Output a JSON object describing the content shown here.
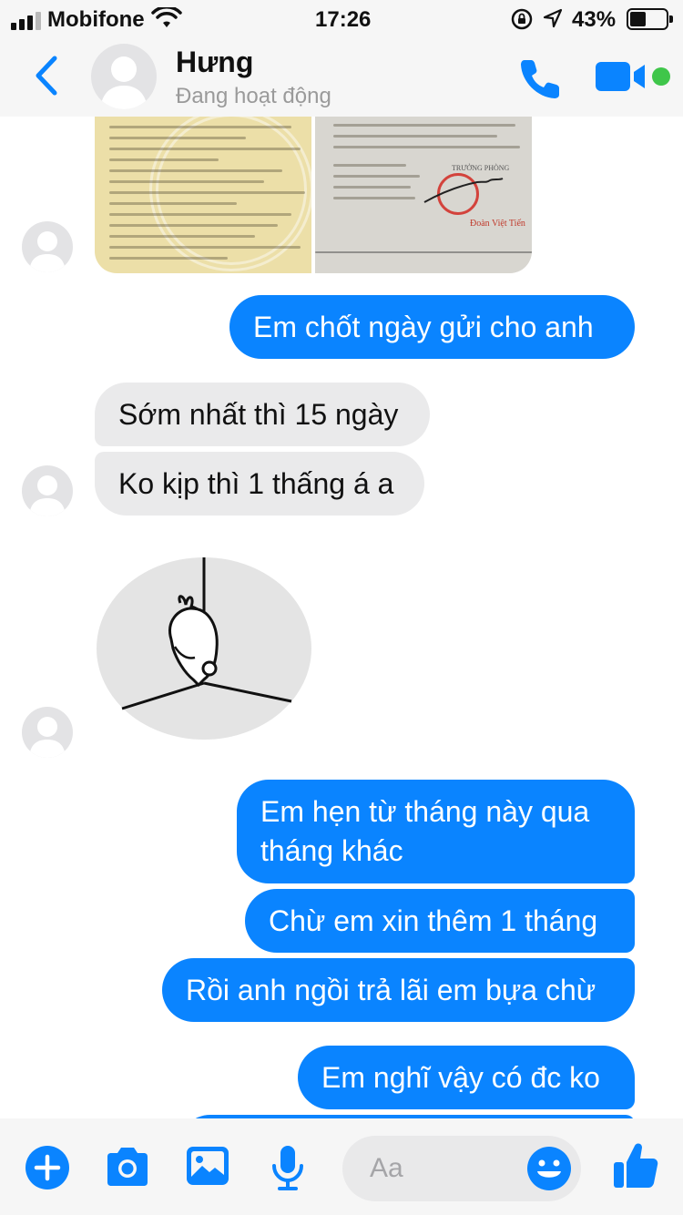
{
  "status_bar": {
    "carrier": "Mobifone",
    "time": "17:26",
    "battery": "43%",
    "battery_level": 0.43
  },
  "header": {
    "contact_name": "Hưng",
    "contact_status": "Đang hoạt động",
    "online": true
  },
  "attachments": {
    "left_document": {
      "lines": [
        "LIMITED",
        "1. Địa chỉ trụ sở chính",
        "K2/67 Hà Khê, Phường Xuân Hà, Quận Thanh Khê, Thành phố Đà Nẵng, Việt Nam",
        "3. Vốn điều lệ",
        "4. Thông tin về chủ sở hữu",
        "Họ và tên: ĐINH XUÂN HƯNG",
        "5. Người đại diện theo pháp luật của công ty"
      ]
    },
    "right_document": {
      "lines": [
        "TRƯỞNG PHÒNG",
        "Đoàn Việt Tiến"
      ]
    }
  },
  "messages": [
    {
      "side": "out",
      "text": "Em chốt ngày gửi cho anh"
    },
    {
      "side": "in",
      "text": "Sớm nhất thì 15 ngày"
    },
    {
      "side": "in",
      "text": "Ko kịp thì 1 thấng á a"
    },
    {
      "side": "out",
      "text": "Em hẹn từ tháng này qua tháng khác"
    },
    {
      "side": "out",
      "text": "Chừ em xin thêm 1 tháng"
    },
    {
      "side": "out",
      "text": "Rồi anh ngồi trả lãi em bựa chừ"
    },
    {
      "side": "out",
      "text": "Em nghĩ vậy có đc ko"
    }
  ],
  "composer": {
    "placeholder": "Aa"
  },
  "colors": {
    "accent": "#0a84ff",
    "incoming_bubble": "#eaeaeb",
    "online": "#3fc64a"
  },
  "icons": [
    "back-icon",
    "phone-icon",
    "video-camera-icon",
    "plus-icon",
    "camera-icon",
    "photo-icon",
    "microphone-icon",
    "emoji-icon",
    "thumbs-up-icon"
  ]
}
